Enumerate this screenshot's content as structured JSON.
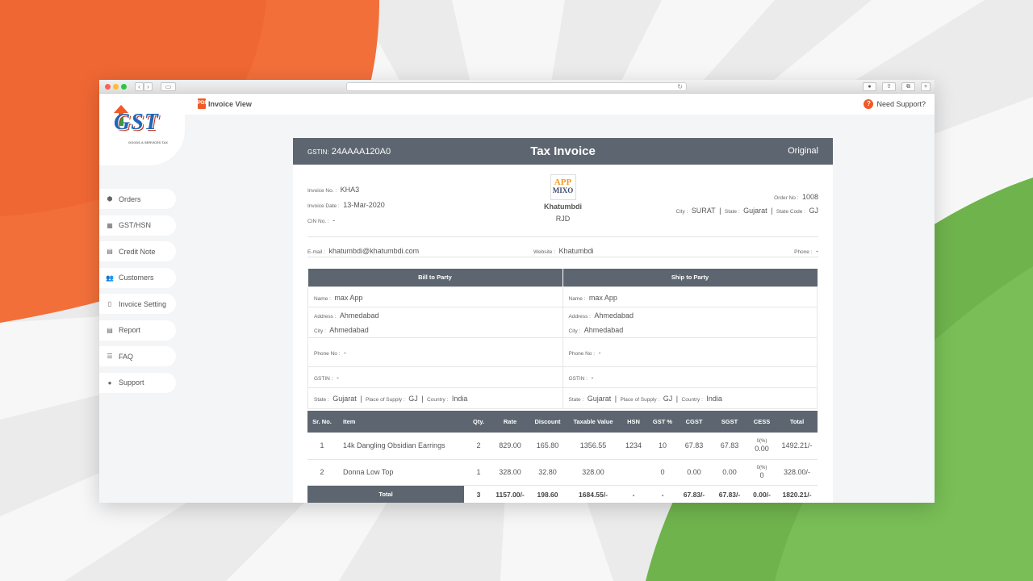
{
  "browser": {
    "back": "‹",
    "forward": "›",
    "sidebar_toggle": "▭",
    "reload": "↻",
    "download": "●",
    "share": "⇪",
    "tabs": "⧉",
    "new_tab": "+"
  },
  "app": {
    "logo_text": "GST",
    "logo_subtitle": "GOODS & SERVICES TAX",
    "page_title": "Invoice View",
    "pdf_glyph": "PDF",
    "support_glyph": "?",
    "support_label": "Need Support?"
  },
  "sidebar": {
    "items": [
      {
        "label": "Orders",
        "icon": "box-icon",
        "glyph": "⬢"
      },
      {
        "label": "GST/HSN",
        "icon": "chart-icon",
        "glyph": "▦"
      },
      {
        "label": "Credit Note",
        "icon": "document-icon",
        "glyph": "▤"
      },
      {
        "label": "Customers",
        "icon": "users-icon",
        "glyph": "👥"
      },
      {
        "label": "Invoice Setting",
        "icon": "file-icon",
        "glyph": "▯"
      },
      {
        "label": "Report",
        "icon": "report-icon",
        "glyph": "▤"
      },
      {
        "label": "FAQ",
        "icon": "list-icon",
        "glyph": "☰"
      },
      {
        "label": "Support",
        "icon": "help-icon",
        "glyph": "●"
      }
    ]
  },
  "invoice": {
    "gstin_label": "GSTIN:",
    "gstin": "24AAAA120A0",
    "title": "Tax Invoice",
    "copy_type": "Original",
    "invoice_no_label": "Invoice No. :",
    "invoice_no": "KHA3",
    "invoice_date_label": "Invoice Date :",
    "invoice_date": "13-Mar-2020",
    "cin_label": "CIN No. :",
    "cin": "-",
    "seller_logo_line1": "APP",
    "seller_logo_line2": "MIXO",
    "seller_name": "Khatumbdi",
    "seller_city": "RJD",
    "order_no_label": "Order No :",
    "order_no": "1008",
    "city_label": "City :",
    "city": "SURAT",
    "state_label": "State :",
    "state": "Gujarat",
    "state_code_label": "State Code :",
    "state_code": "GJ",
    "separator": "|",
    "email_label": "E-mail :",
    "email": "khatumbdi@khatumbdi.com",
    "website_label": "Website :",
    "website": "Khatumbdi",
    "phone_label": "Phone :",
    "phone": "-"
  },
  "party": {
    "bill_header": "Bill to Party",
    "ship_header": "Ship to Party",
    "name_label": "Name :",
    "address_label": "Address :",
    "city_label": "City :",
    "phone_label": "Phone No :",
    "gstin_label": "GSTIN :",
    "state_label": "State :",
    "pos_label": "Place of Supply :",
    "country_label": "Country :",
    "separator": "|",
    "bill": {
      "name": "max App",
      "address": "Ahmedabad",
      "city": "Ahmedabad",
      "phone": "-",
      "gstin": "-",
      "state": "Gujarat",
      "pos": "GJ",
      "country": "India"
    },
    "ship": {
      "name": "max App",
      "address": "Ahmedabad",
      "city": "Ahmedabad",
      "phone": "-",
      "gstin": "-",
      "state": "Gujarat",
      "pos": "GJ",
      "country": "India"
    }
  },
  "items": {
    "headers": [
      "Sr. No.",
      "Item",
      "Qty.",
      "Rate",
      "Discount",
      "Taxable Value",
      "HSN",
      "GST %",
      "CGST",
      "SGST",
      "CESS",
      "Total"
    ],
    "rows": [
      {
        "sr": "1",
        "item": "14k Dangling Obsidian Earrings",
        "qty": "2",
        "rate": "829.00",
        "discount": "165.80",
        "taxable": "1356.55",
        "hsn": "1234",
        "gst": "10",
        "cgst": "67.83",
        "sgst": "67.83",
        "cess_pct": "0(%)",
        "cess": "0.00",
        "total": "1492.21/-"
      },
      {
        "sr": "2",
        "item": "Donna Low Top",
        "qty": "1",
        "rate": "328.00",
        "discount": "32.80",
        "taxable": "328.00",
        "hsn": "",
        "gst": "0",
        "cgst": "0.00",
        "sgst": "0.00",
        "cess_pct": "0(%)",
        "cess": "0",
        "total": "328.00/-"
      }
    ],
    "total": {
      "label": "Total",
      "qty": "3",
      "rate": "1157.00/-",
      "discount": "198.60",
      "taxable": "1684.55/-",
      "hsn": "-",
      "gst": "-",
      "cgst": "67.83/-",
      "sgst": "67.83/-",
      "cess": "0.00/-",
      "total": "1820.21/-"
    }
  }
}
